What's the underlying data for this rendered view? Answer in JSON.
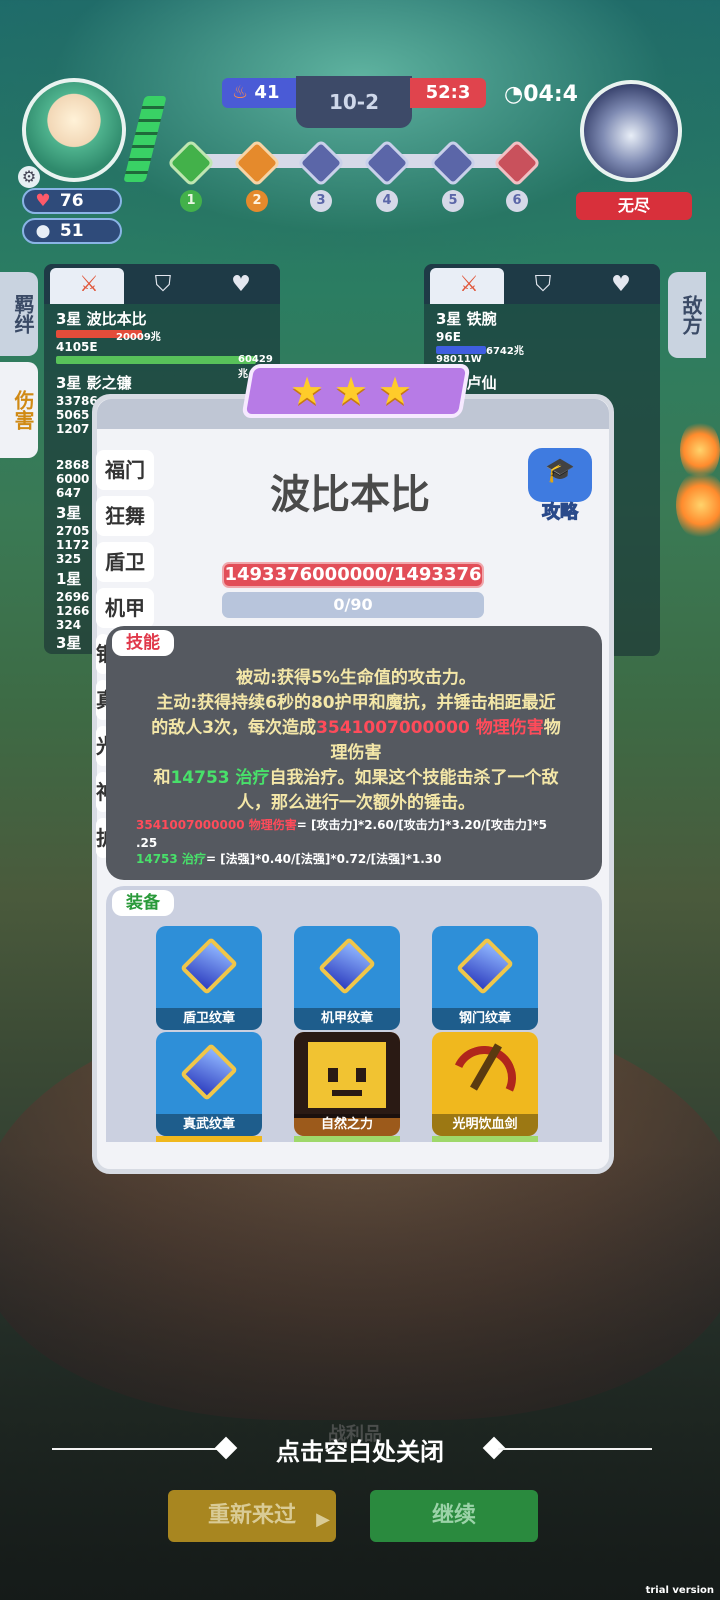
{
  "hud": {
    "player_hp": "76",
    "player_coins": "51",
    "score_blue": "41",
    "round": "10-2",
    "score_red": "52:3",
    "timer": "04:4",
    "enemy_name": "无尽",
    "stages": [
      "1",
      "2",
      "3",
      "4",
      "5",
      "6"
    ]
  },
  "side_tabs": {
    "bond": "羁绊",
    "damage": "伤害",
    "enemy": "敌方"
  },
  "left_team": [
    {
      "name": "3星 波比本比",
      "dmg": "4105E",
      "bar1": "20009兆",
      "bar2": "60429兆"
    },
    {
      "name": "3星 影之镰",
      "dmg": "33786",
      "dmg2": "5065",
      "dmg3": "1207"
    },
    {
      "name": "",
      "dmg": "2868",
      "dmg2": "6000",
      "dmg3": "647"
    },
    {
      "name": "3星",
      "dmg": "2705",
      "dmg2": "1172",
      "dmg3": "325"
    },
    {
      "name": "1星",
      "dmg": "2696",
      "dmg2": "1266",
      "dmg3": "324"
    },
    {
      "name": "3星",
      "dmg": ""
    }
  ],
  "right_team": [
    {
      "name": "3星 铁腕",
      "dmg": "96E",
      "bar1": "6742兆",
      "sub": "98011W"
    },
    {
      "name": "3星 卢仙",
      "dmg": ""
    }
  ],
  "modal": {
    "stars": 3,
    "hero_name": "波比本比",
    "strategy_label": "攻略",
    "hp_text": "1493376000000/1493376",
    "mp_text": "0/90",
    "side_items": [
      "福门",
      "狂舞",
      "盾卫",
      "机甲",
      "钢",
      "真",
      "光",
      "神",
      "护"
    ],
    "skill_tag": "技能",
    "skill": {
      "line1": "被动:获得5%生命值的攻击力。",
      "line2": "主动:获得持续6秒的80护甲和魔抗，并锤击相距最近",
      "line3_pre": "的敌人3次，每次造成",
      "line3_red": "3541007000000 物理伤害",
      "line3_post": "物",
      "line4": "理伤害",
      "line5_pre": "和",
      "line5_green": "14753 治疗",
      "line5_post": "自我治疗。如果这个技能击杀了一个敌",
      "line6": "人，那么进行一次额外的锤击。",
      "f1_red": "3541007000000 物理伤害",
      "f1_rest": "= [攻击力]*2.60/[攻击力]*3.20/[攻击力]*5",
      "f1_cont": ".25",
      "f2_green": "14753 治疗",
      "f2_rest": "= [法强]*0.40/[法强]*0.72/[法强]*1.30"
    },
    "equip_tag": "装备",
    "equipment": [
      {
        "name": "盾卫纹章",
        "icon": "emblem-icon",
        "bg": "#2e8fd8"
      },
      {
        "name": "机甲纹章",
        "icon": "emblem-icon",
        "bg": "#2e8fd8"
      },
      {
        "name": "钢门纹章",
        "icon": "emblem-icon",
        "bg": "#2e8fd8"
      },
      {
        "name": "真武纹章",
        "icon": "emblem-icon",
        "bg": "#2e8fd8"
      },
      {
        "name": "自然之力",
        "icon": "crown-icon",
        "bg": "#f08a2a"
      },
      {
        "name": "光明饮血剑",
        "icon": "sword-icon",
        "bg": "#f0b81e"
      }
    ]
  },
  "footer": {
    "close_hint": "点击空白处关闭",
    "retry_label": "重新来过",
    "continue_label": "继续",
    "loot_label": "战利品",
    "trial": "trial version"
  }
}
